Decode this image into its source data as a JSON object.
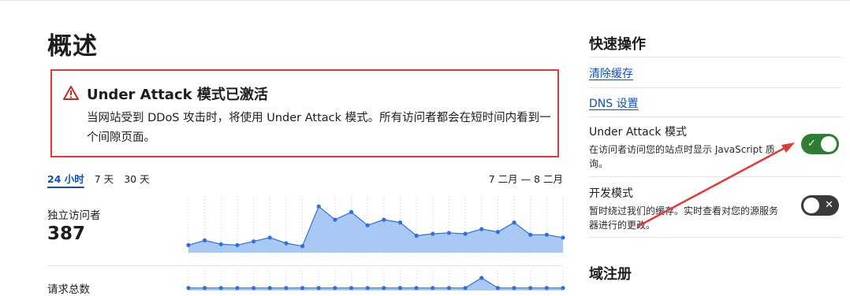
{
  "overview": {
    "title": "概述",
    "alert": {
      "title": "Under Attack 模式已激活",
      "body": "当网站受到 DDoS 攻击时，将使用 Under Attack 模式。所有访问者都会在短时间内看到一个间隙页面。"
    },
    "time_range": {
      "tabs": [
        "24 小时",
        "7 天",
        "30 天"
      ],
      "selected": "24 小时",
      "date_range": "7 二月 — 8 二月"
    },
    "metrics": [
      {
        "label": "独立访问者",
        "value": "387"
      },
      {
        "label": "请求总数"
      }
    ]
  },
  "quick_actions": {
    "title": "快速操作",
    "purge_cache": "清除缓存",
    "dns_settings": "DNS 设置",
    "under_attack": {
      "title": "Under Attack 模式",
      "description": "在访问者访问您的站点时显示 JavaScript 质询。",
      "enabled": true
    },
    "dev_mode": {
      "title": "开发模式",
      "description": "暂时绕过我们的缓存。实时查看对您的源服务器进行的更改。",
      "enabled": false
    }
  },
  "domain_registration": {
    "title": "域注册"
  },
  "colors": {
    "accent_blue": "#0a51c4",
    "alert_red": "#e53935",
    "toggle_on": "#2e7d32",
    "toggle_off": "#3a3a3a",
    "chart_fill": "#a9c9f5",
    "chart_line": "#2f6fe0"
  },
  "icons": {
    "alert": "warning-triangle-icon",
    "toggle_on": "check-icon",
    "toggle_off": "x-icon"
  },
  "chart_data": [
    {
      "type": "area",
      "title": "独立访问者",
      "x": [
        0,
        1,
        2,
        3,
        4,
        5,
        6,
        7,
        8,
        9,
        10,
        11,
        12,
        13,
        14,
        15,
        16,
        17,
        18,
        19,
        20,
        21,
        22,
        23
      ],
      "values": [
        8,
        13,
        9,
        8,
        12,
        16,
        10,
        7,
        49,
        35,
        43,
        29,
        35,
        32,
        18,
        20,
        21,
        20,
        25,
        22,
        32,
        19,
        19,
        16
      ],
      "ylim": [
        0,
        55
      ],
      "grid": true
    },
    {
      "type": "area",
      "title": "请求总数",
      "x": [
        0,
        1,
        2,
        3,
        4,
        5,
        6,
        7,
        8,
        9,
        10,
        11,
        12,
        13,
        14,
        15,
        16,
        17,
        18,
        19,
        20,
        21,
        22,
        23
      ],
      "values": [
        2,
        2,
        2,
        2,
        2,
        2,
        2,
        2,
        2,
        2,
        2,
        2,
        2,
        2,
        2,
        2,
        2,
        2,
        10,
        2,
        2,
        2,
        2,
        2
      ],
      "ylim": [
        0,
        10
      ],
      "grid": true
    }
  ]
}
